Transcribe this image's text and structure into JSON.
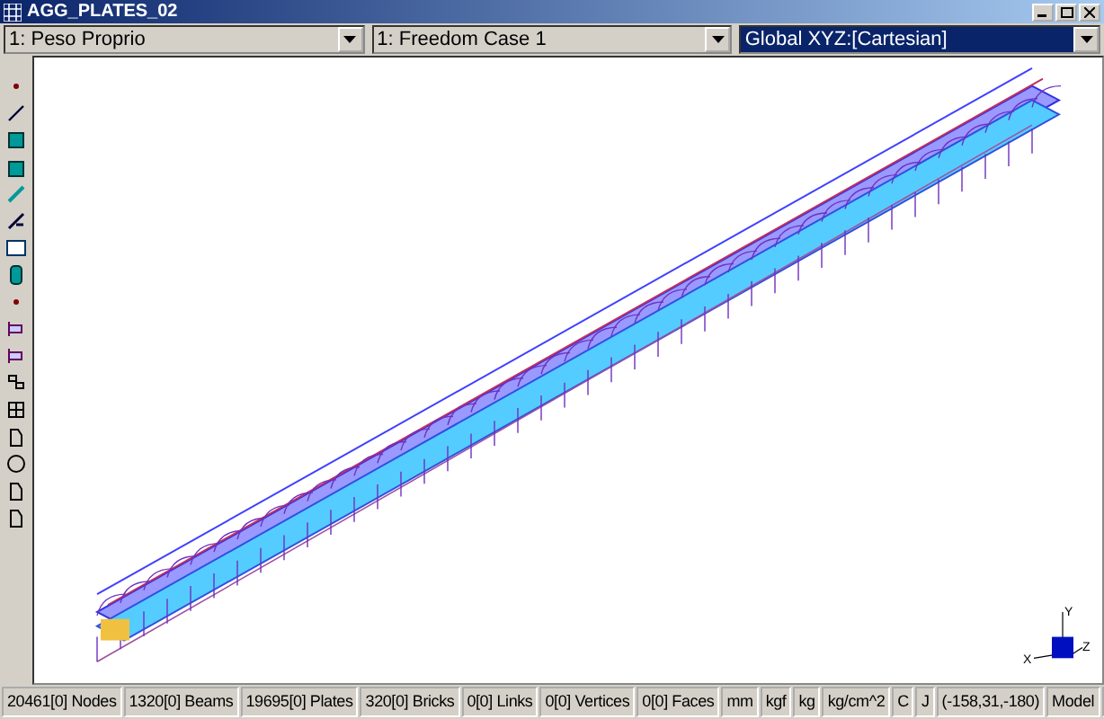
{
  "window": {
    "title": "AGG_PLATES_02"
  },
  "selectors": [
    {
      "value": "1: Peso Proprio",
      "focused": false
    },
    {
      "value": "1: Freedom Case 1",
      "focused": false
    },
    {
      "value": "Global XYZ:[Cartesian]",
      "focused": true
    }
  ],
  "axis_triad": {
    "x_label": "X",
    "y_label": "Y",
    "z_label": "Z"
  },
  "status_bar": [
    "20461[0] Nodes",
    "1320[0] Beams",
    "19695[0] Plates",
    "320[0] Bricks",
    "0[0] Links",
    "0[0] Vertices",
    "0[0] Faces",
    "mm",
    "kgf",
    "kg",
    "kg/cm^2",
    "C",
    "J",
    "(-158,31,-180)",
    "Model"
  ]
}
